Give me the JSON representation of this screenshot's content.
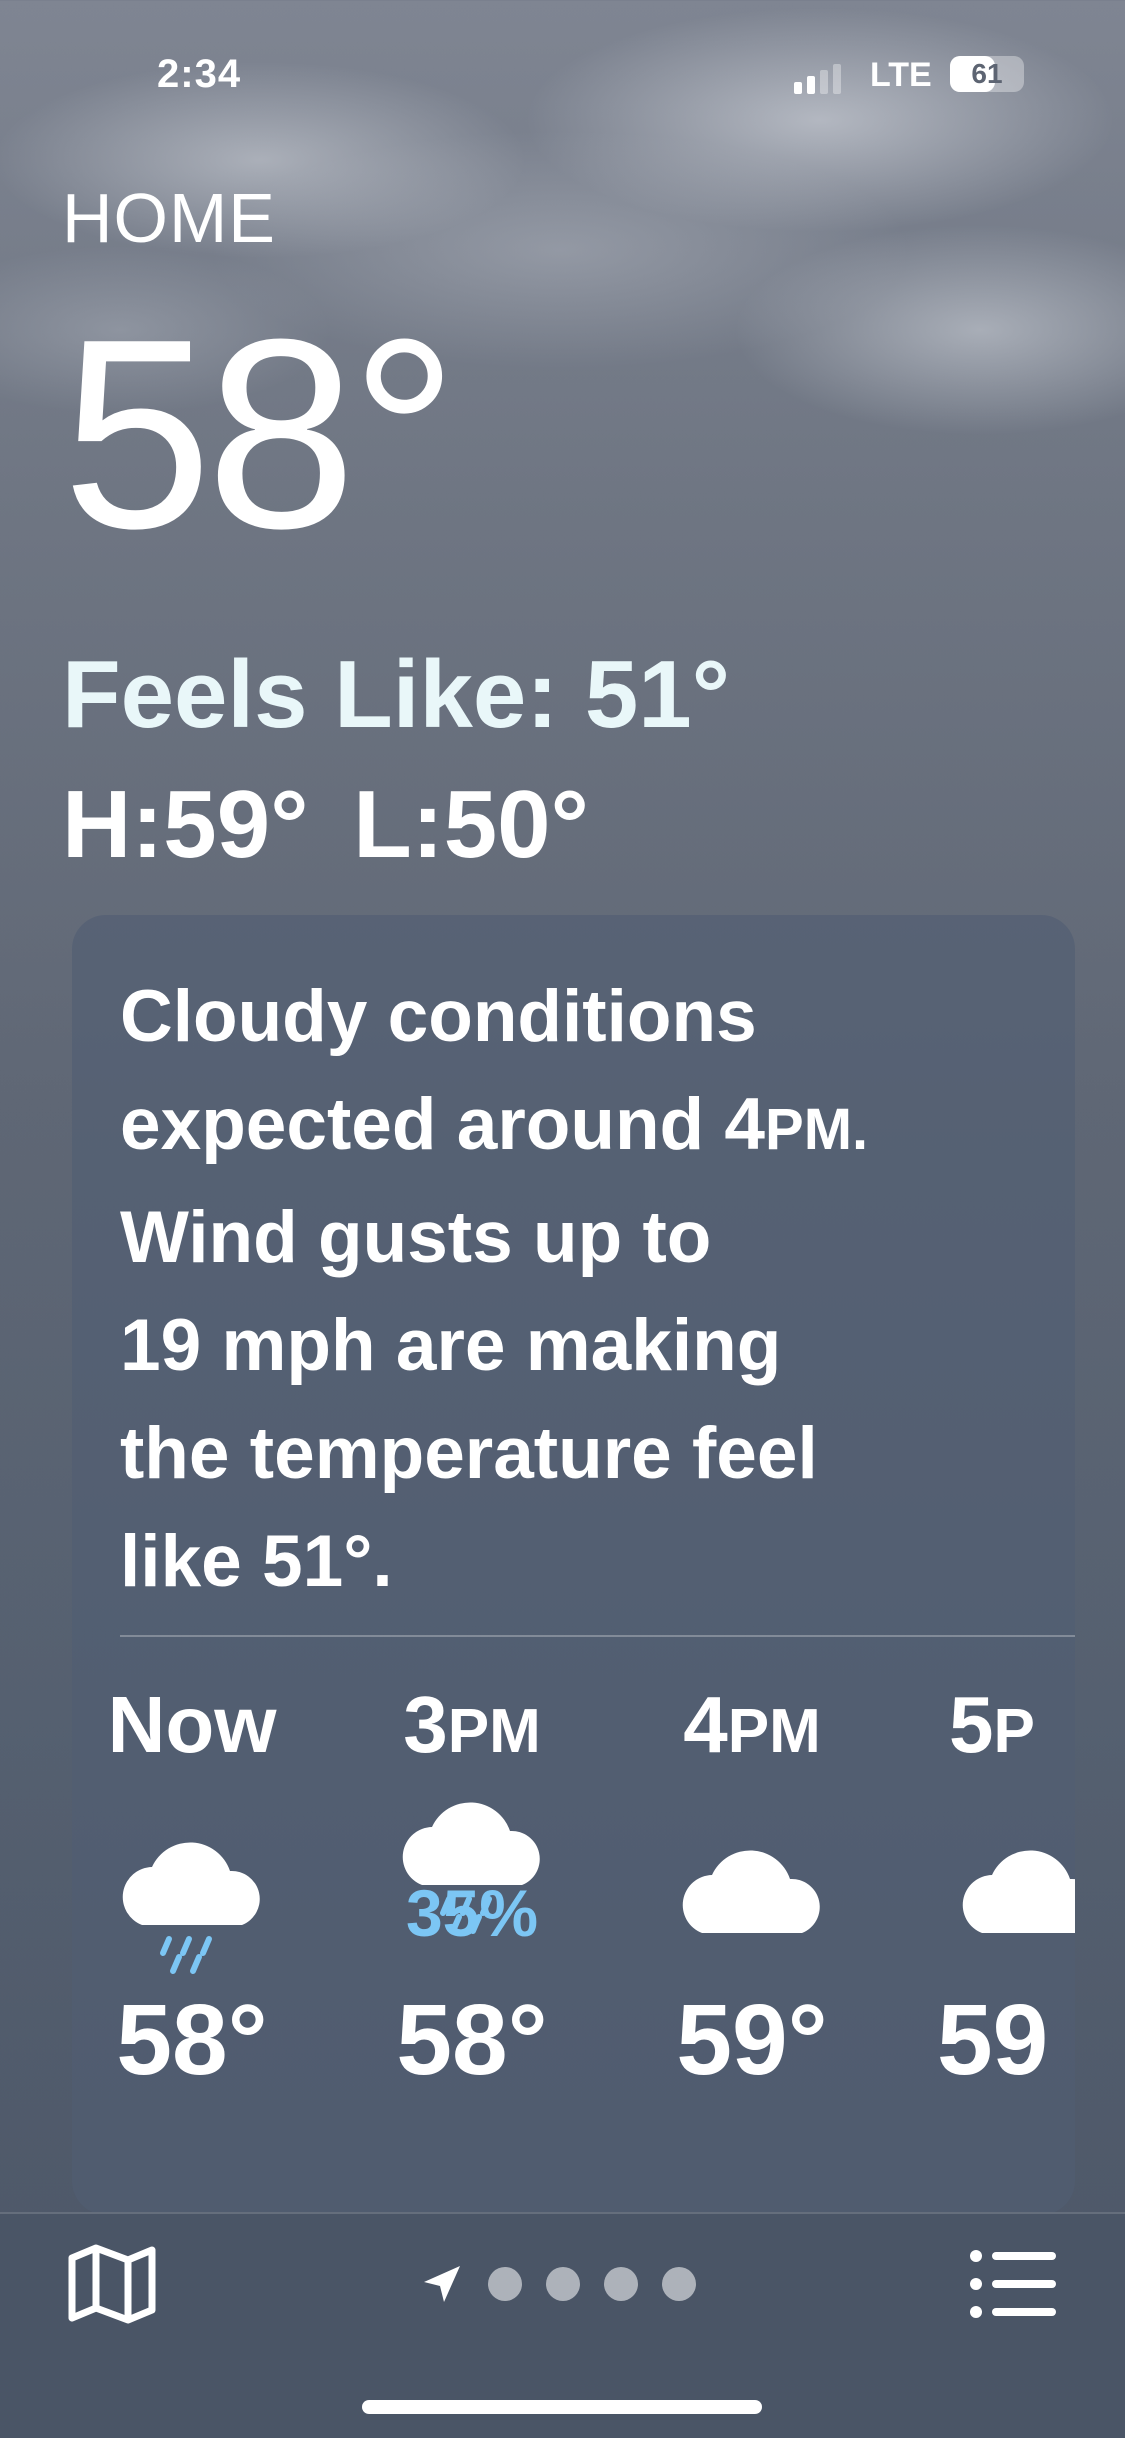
{
  "status_bar": {
    "time": "2:34",
    "network": "LTE",
    "battery": "61",
    "battery_level": 0.61
  },
  "weather": {
    "location": "HOME",
    "temperature": "58°",
    "feels_like": "Feels Like: 51°",
    "high": "H:59°",
    "low": "L:50°"
  },
  "summary": {
    "line1": "Cloudy conditions",
    "line2_pre": "expected around 4",
    "line2_suffix": "PM.",
    "line3": "Wind gusts up to",
    "line4": "19 mph are making",
    "line5": "the temperature feel",
    "line6": "like 51°."
  },
  "hourly": [
    {
      "label": "Now",
      "suffix": "",
      "icon": "cloud-rain-icon",
      "precip": "",
      "temp": "58°"
    },
    {
      "label": "3",
      "suffix": "PM",
      "icon": "cloud-rain-icon",
      "precip": "35%",
      "temp": "58°"
    },
    {
      "label": "4",
      "suffix": "PM",
      "icon": "cloud-icon",
      "precip": "",
      "temp": "59°"
    },
    {
      "label": "5",
      "suffix": "P",
      "icon": "cloud-icon",
      "precip": "",
      "temp": "59"
    }
  ],
  "colors": {
    "precip": "#7cc6f4",
    "feels_like": "#e9f7f9"
  },
  "toolbar": {
    "map_icon": "map-icon",
    "location_icon": "location-arrow-icon",
    "list_icon": "list-icon",
    "page_count": 5
  }
}
